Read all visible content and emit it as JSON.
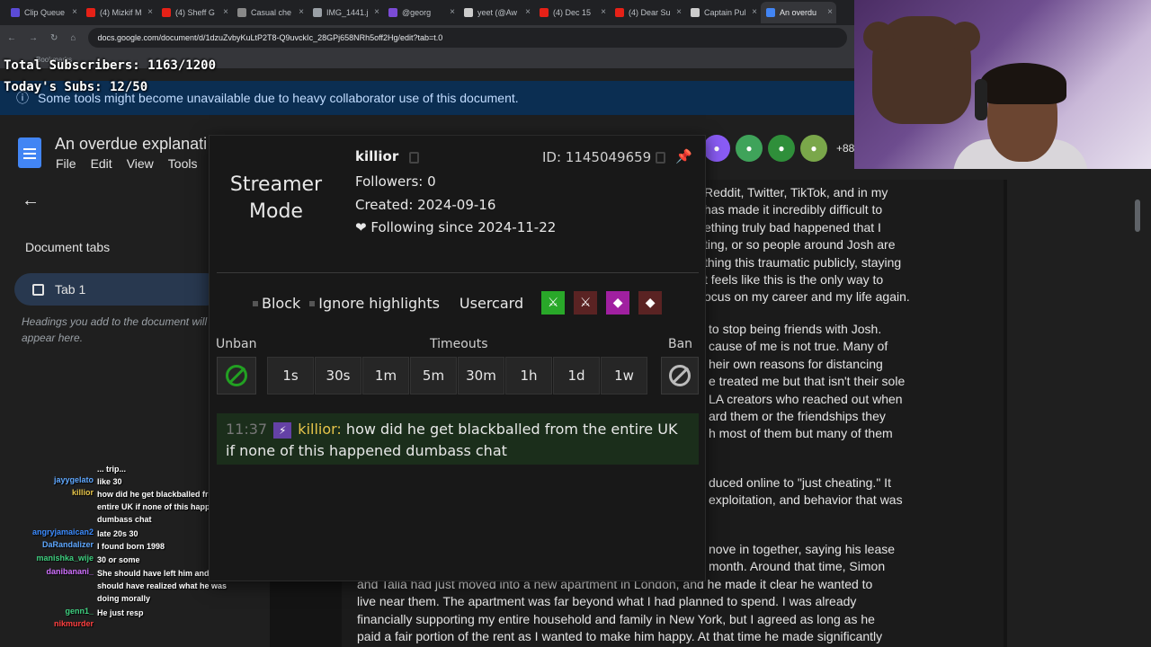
{
  "browser": {
    "tabs": [
      {
        "label": "Clip Queue",
        "color": "#5b4bd6"
      },
      {
        "label": "(4) Mizkif M",
        "color": "#e62117"
      },
      {
        "label": "(4) Sheff G",
        "color": "#e62117"
      },
      {
        "label": "Casual che",
        "color": "#888888"
      },
      {
        "label": "IMG_1441.j",
        "color": "#9aa0a6"
      },
      {
        "label": "@georg",
        "color": "#7b4bd6"
      },
      {
        "label": "yeet (@Aw",
        "color": "#cccccc"
      },
      {
        "label": "(4) Dec 15",
        "color": "#e62117"
      },
      {
        "label": "(4) Dear Su",
        "color": "#e62117"
      },
      {
        "label": "Captain Pul",
        "color": "#cccccc"
      },
      {
        "label": "An overdu",
        "color": "#4285f4"
      }
    ],
    "url": "docs.google.com/document/d/1dzuZvbyKuLtP2T8-Q9uvckIc_28GPj658NRh5off2Hg/edit?tab=t.0",
    "bookmarks": "Bookmarks"
  },
  "stream_overlay": {
    "total_subs": "Total Subscribers: 1163/1200",
    "today_subs": "Today's Subs: 12/50"
  },
  "docs": {
    "banner": "Some tools might become unavailable due to heavy collaborator use of this document.",
    "title": "An overdue explanati",
    "menu": [
      "File",
      "Edit",
      "View",
      "Tools"
    ],
    "sidebar_title": "Document tabs",
    "tab1_label": "Tab 1",
    "hint": "Headings you add to the document will appear here.",
    "collaborators_more": "+88",
    "right_text_lines": [
      "Reddit, Twitter, TikTok, and in my",
      "has made it incredibly difficult to",
      "ething truly bad happened that I",
      "ting, or so people around Josh are",
      "thing this traumatic publicly, staying",
      "t feels like this is the only way to",
      "ocus on my career and my life again."
    ],
    "right_text_lines_2": [
      "to stop being friends with Josh.",
      "cause of me is not true. Many of",
      "heir own reasons for distancing",
      "e treated me but that isn't their sole",
      "LA creators who reached out when",
      "ard them or the friendships they",
      "h most of them but many of them"
    ],
    "right_text_lines_3": [
      "duced online to \"just cheating.\" It",
      "exploitation, and behavior that was"
    ],
    "right_text_lines_4": [
      "nove in together, saying his lease",
      "month. Around that time, Simon"
    ],
    "bottom_lines": [
      "and Talia had just moved into a new apartment in London, and he made it clear he wanted to",
      "live near them. The apartment was far beyond what I had planned to spend. I was already",
      "financially supporting my entire household and family in New York, but I agreed as long as he",
      "paid a fair portion of the rent as I wanted to make him happy. At that time he made significantly"
    ]
  },
  "chat": [
    {
      "user": "",
      "msg": "... trip...",
      "ucolor": "#ffffff"
    },
    {
      "user": "jayygelato",
      "msg": "like 30",
      "ucolor": "#5fa8ff"
    },
    {
      "user": "killior",
      "msg": "how did he get blackballed from the entire UK if none of this happened dumbass chat",
      "ucolor": "#e6c44a"
    },
    {
      "user": "angryjamaican2",
      "msg": "late 20s 30",
      "ucolor": "#3c8cff"
    },
    {
      "user": "DaRandalizer",
      "msg": "I found born 1998",
      "ucolor": "#5fa8ff"
    },
    {
      "user": "manishka_wije",
      "msg": "30 or some",
      "ucolor": "#3fd080"
    },
    {
      "user": "danibanani_",
      "msg": "She should have left him and he should have realized what he was doing morally",
      "ucolor": "#d070ff"
    },
    {
      "user": "genn1_",
      "msg": "He just resp",
      "ucolor": "#3fd080"
    },
    {
      "user": "nikmurder",
      "msg": "",
      "ucolor": "#ff4040"
    }
  ],
  "usercard": {
    "streamer_mode": "Streamer Mode",
    "username": "killior",
    "followers": "Followers: 0",
    "created": "Created: 2024-09-16",
    "following": "Following since 2024-11-22",
    "heart": "❤",
    "id": "ID: 1145049659",
    "block": "Block",
    "ignore": "Ignore highlights",
    "usercard": "Usercard",
    "unban": "Unban",
    "timeouts_label": "Timeouts",
    "ban": "Ban",
    "timeouts": [
      "1s",
      "30s",
      "1m",
      "5m",
      "30m",
      "1h",
      "1d",
      "1w"
    ],
    "message": {
      "time": "11:37",
      "author": "killior:",
      "text": "how did he get blackballed from the entire UK if none of this happened dumbass chat"
    }
  }
}
